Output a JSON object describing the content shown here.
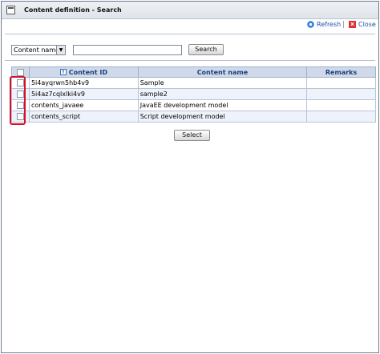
{
  "window": {
    "title": "Content definition - Search"
  },
  "toolbar": {
    "refresh_label": "Refresh",
    "close_label": "Close",
    "close_glyph": "x"
  },
  "search": {
    "field_selected": "Content name",
    "field_value": "",
    "button_label": "Search",
    "arrow_glyph": "▼"
  },
  "table": {
    "columns": {
      "content_id": "Content ID",
      "content_name": "Content name",
      "remarks": "Remarks"
    },
    "sort_glyph": "↑",
    "rows": [
      {
        "content_id": "5i4ayqrwn5hb4v9",
        "content_name": "Sample",
        "remarks": ""
      },
      {
        "content_id": "5i4az7cqlxlki4v9",
        "content_name": "sample2",
        "remarks": ""
      },
      {
        "content_id": "contents_javaee",
        "content_name": "JavaEE development model",
        "remarks": ""
      },
      {
        "content_id": "contents_script",
        "content_name": "Script development model",
        "remarks": ""
      }
    ]
  },
  "footer": {
    "select_label": "Select"
  },
  "colors": {
    "highlight": "#d8102a",
    "header_bg": "#cfd9ea",
    "link": "#1b56a8"
  },
  "icons": [
    "window-icon",
    "refresh-icon",
    "close-icon",
    "sort-asc-icon",
    "dropdown-arrow-icon"
  ]
}
